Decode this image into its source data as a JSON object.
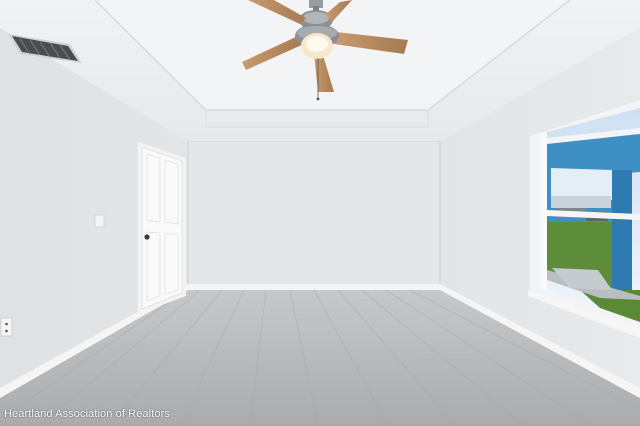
{
  "photo": {
    "watermark": "Heartland Association of Realtors"
  },
  "colors": {
    "wall": "#e4e6e7",
    "ceiling": "#eeeff0",
    "floor": "#b7b9bb",
    "trim": "#f7f7f7",
    "sky": "#dfe9f5",
    "lawn": "#5d8c3a",
    "house_blue": "#3d8fc4"
  }
}
